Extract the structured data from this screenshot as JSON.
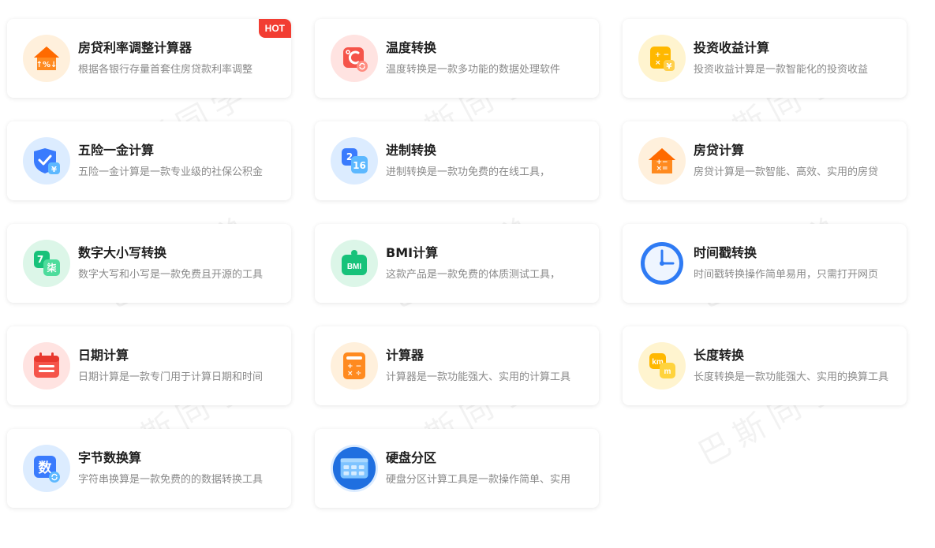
{
  "watermark": "巴斯同学",
  "badge": "HOT",
  "tools": [
    {
      "title": "房贷利率调整计算器",
      "desc": "根据各银行存量首套住房贷款利率调整",
      "icon": "house-rate-icon",
      "bg": "#fff0dc"
    },
    {
      "title": "温度转换",
      "desc": "温度转换是一款多功能的数据处理软件",
      "icon": "temperature-icon",
      "bg": "#ffe3e1"
    },
    {
      "title": "投资收益计算",
      "desc": "投资收益计算是一款智能化的投资收益",
      "icon": "investment-icon",
      "bg": "#fff4cf"
    },
    {
      "title": "五险一金计算",
      "desc": "五险一金计算是一款专业级的社保公积金",
      "icon": "shield-yuan-icon",
      "bg": "#dcecff"
    },
    {
      "title": "进制转换",
      "desc": "进制转换是一款功免费的在线工具，",
      "icon": "base-convert-icon",
      "bg": "#dcecff"
    },
    {
      "title": "房贷计算",
      "desc": "房贷计算是一款智能、高效、实用的房贷",
      "icon": "house-loan-icon",
      "bg": "#fff0dc"
    },
    {
      "title": "数字大小写转换",
      "desc": "数字大写和小写是一款免费且开源的工具",
      "icon": "number-case-icon",
      "bg": "#dcf6e8"
    },
    {
      "title": "BMI计算",
      "desc": "这款产品是一款免费的体质测试工具，",
      "icon": "bmi-icon",
      "bg": "#dcf6e8",
      "icon_text": "BMI"
    },
    {
      "title": "时间戳转换",
      "desc": "时间戳转换操作简单易用，只需打开网页",
      "icon": "clock-icon",
      "bg": "#ffffff"
    },
    {
      "title": "日期计算",
      "desc": "日期计算是一款专门用于计算日期和时间",
      "icon": "calendar-icon",
      "bg": "#ffe3e1"
    },
    {
      "title": "计算器",
      "desc": "计算器是一款功能强大、实用的计算工具",
      "icon": "calculator-icon",
      "bg": "#fff0dc"
    },
    {
      "title": "长度转换",
      "desc": "长度转换是一款功能强大、实用的换算工具",
      "icon": "length-icon",
      "bg": "#fff4cf",
      "icon_text": "km"
    },
    {
      "title": "字节数换算",
      "desc": "字符串换算是一款免费的的数据转换工具",
      "icon": "bytes-icon",
      "bg": "#dcecff",
      "icon_text": "数"
    },
    {
      "title": "硬盘分区",
      "desc": "硬盘分区计算工具是一款操作简单、实用",
      "icon": "disk-partition-icon",
      "bg": "#dcecff"
    }
  ]
}
